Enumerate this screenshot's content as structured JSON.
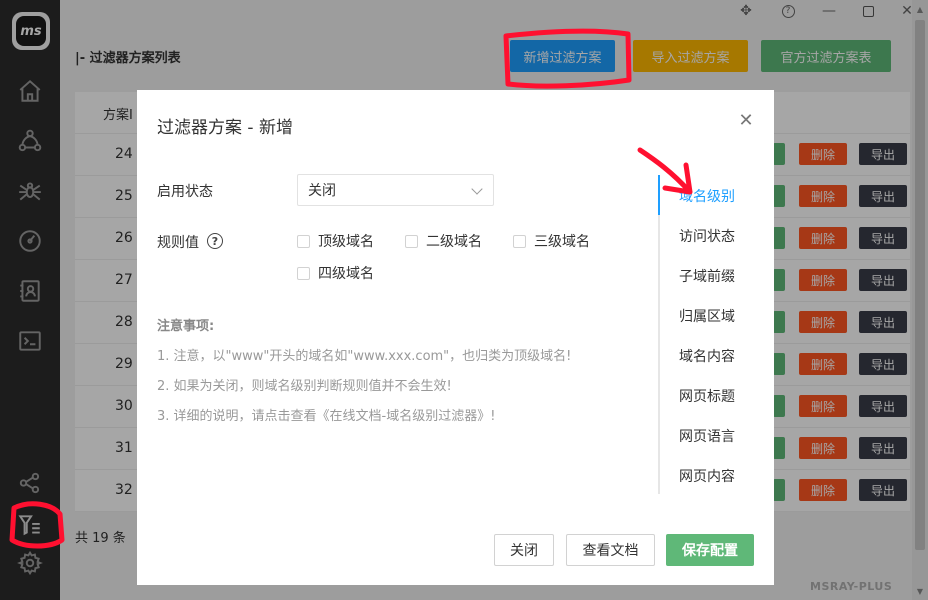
{
  "app": {
    "logo_text": "ms",
    "brand": "MSRAY-PLUS"
  },
  "sidebar": {
    "icons": [
      "home-icon",
      "nodes-icon",
      "spider-icon",
      "gauge-icon",
      "contacts-icon",
      "terminal-icon",
      "share-icon",
      "filter-list-icon",
      "gear-icon"
    ]
  },
  "topbar": {
    "icons": [
      "move-icon",
      "help-icon",
      "minimize-icon",
      "maximize-icon",
      "close-icon"
    ]
  },
  "page": {
    "title": "|- 过滤器方案列表",
    "buttons": {
      "new": "新增过滤方案",
      "import": "导入过滤方案",
      "official": "官方过滤方案表"
    },
    "table": {
      "header_id": "方案I",
      "row_ids": [
        "24",
        "25",
        "26",
        "27",
        "28",
        "29",
        "30",
        "31",
        "32"
      ],
      "delete_label": "删除",
      "export_label": "导出"
    },
    "count": "共 19 条"
  },
  "dialog": {
    "title": "过滤器方案 - 新增",
    "status_label": "启用状态",
    "status_value": "关闭",
    "rule_label": "规则值",
    "checkboxes": [
      "顶级域名",
      "二级域名",
      "三级域名",
      "四级域名"
    ],
    "notes_title": "注意事项:",
    "notes": [
      "1. 注意，以\"www\"开头的域名如\"www.xxx.com\"，也归类为顶级域名!",
      "2. 如果为关闭，则域名级别判断规则值并不会生效!",
      "3. 详细的说明，请点击查看《在线文档-域名级别过滤器》!"
    ],
    "nav": [
      "域名级别",
      "访问状态",
      "子域前缀",
      "归属区域",
      "域名内容",
      "网页标题",
      "网页语言",
      "网页内容"
    ],
    "nav_active": "域名级别",
    "footer": {
      "close": "关闭",
      "docs": "查看文档",
      "save": "保存配置"
    }
  },
  "colors": {
    "accent": "#1e9fff",
    "save_green": "#5fb878",
    "annotation_red": "#ff1030"
  }
}
